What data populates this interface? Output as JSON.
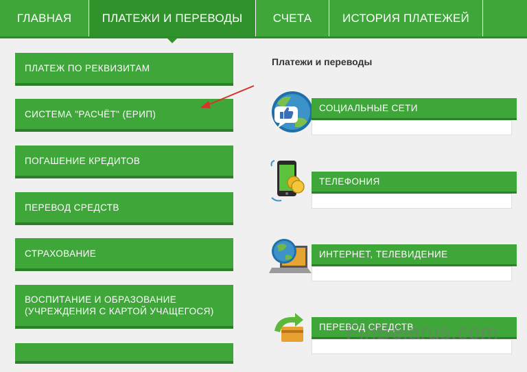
{
  "nav": {
    "tabs": [
      {
        "label": "ГЛАВНАЯ"
      },
      {
        "label": "ПЛАТЕЖИ И ПЕРЕВОДЫ"
      },
      {
        "label": "СЧЕТА"
      },
      {
        "label": "ИСТОРИЯ ПЛАТЕЖЕЙ"
      },
      {
        "label": ""
      }
    ],
    "active_tab": "ПЛАТЕЖИ И ПЕРЕВОДЫ"
  },
  "left_menu": {
    "items": [
      {
        "label": "ПЛАТЕЖ ПО РЕКВИЗИТАМ"
      },
      {
        "label": "СИСТЕМА \"РАСЧЁТ\" (ЕРИП)"
      },
      {
        "label": "ПОГАШЕНИЕ КРЕДИТОВ"
      },
      {
        "label": "ПЕРЕВОД СРЕДСТВ"
      },
      {
        "label": "СТРАХОВАНИЕ"
      },
      {
        "label": "ВОСПИТАНИЕ И ОБРАЗОВАНИЕ (УЧРЕЖДЕНИЯ С КАРТОЙ УЧАЩЕГОСЯ)"
      },
      {
        "label": ""
      }
    ]
  },
  "right_panel": {
    "title": "Платежи и переводы",
    "categories": [
      {
        "label": "СОЦИАЛЬНЫЕ СЕТИ",
        "icon": "social-networks-icon"
      },
      {
        "label": "ТЕЛЕФОНИЯ",
        "icon": "phone-icon"
      },
      {
        "label": "ИНТЕРНЕТ, ТЕЛЕВИДЕНИЕ",
        "icon": "internet-tv-icon"
      },
      {
        "label": "ПЕРЕВОД СРЕДСТВ",
        "icon": "transfer-icon"
      }
    ]
  },
  "watermark": "FinBelarus.com",
  "colors": {
    "accent": "#3fa63a",
    "accent_dark": "#2d8029",
    "arrow": "#d9312b",
    "background": "#f0f0f0"
  }
}
